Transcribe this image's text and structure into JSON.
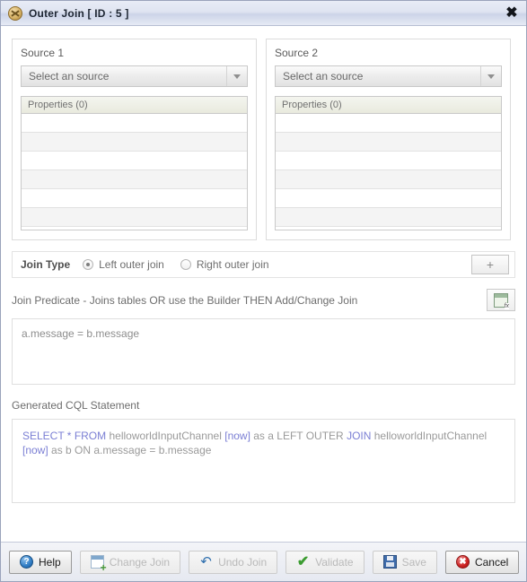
{
  "window": {
    "title": "Outer Join [ ID : 5 ]",
    "title_icon": "outer-join-icon",
    "close_label": "✖"
  },
  "sources": [
    {
      "label": "Source 1",
      "combo_value": "Select an source",
      "combo_arrow": "chevron-down-icon",
      "properties_header": "Properties (0)",
      "rows": 7
    },
    {
      "label": "Source 2",
      "combo_value": "Select an source",
      "combo_arrow": "chevron-down-icon",
      "properties_header": "Properties (0)",
      "rows": 7
    }
  ],
  "join_type": {
    "label": "Join Type",
    "options": [
      {
        "label": "Left outer join",
        "checked": true
      },
      {
        "label": "Right outer join",
        "checked": false
      }
    ],
    "add_button_label": "+"
  },
  "predicate": {
    "label": "Join Predicate - Joins tables OR use the Builder THEN Add/Change Join",
    "builder_icon": "expression-builder-icon",
    "value": "a.message  =  b.message"
  },
  "generated_cql": {
    "label": "Generated CQL Statement",
    "tokens": [
      {
        "text": "SELECT",
        "type": "keyword"
      },
      {
        "text": " * ",
        "type": "keyword"
      },
      {
        "text": "FROM",
        "type": "keyword"
      },
      {
        "text": "  helloworldInputChannel ",
        "type": "identifier"
      },
      {
        "text": "[now]",
        "type": "keyword"
      },
      {
        "text": " as a LEFT OUTER ",
        "type": "identifier"
      },
      {
        "text": "JOIN",
        "type": "keyword"
      },
      {
        "text": "  helloworldInputChannel ",
        "type": "identifier"
      },
      {
        "text": "[now]",
        "type": "keyword"
      },
      {
        "text": " as b ON a.message  =  b.message",
        "type": "identifier"
      }
    ],
    "plain_text": "SELECT * FROM  helloworldInputChannel [now] as a LEFT OUTER JOIN  helloworldInputChannel [now] as b ON a.message  =  b.message"
  },
  "buttons": [
    {
      "label": "Help",
      "icon": "help-icon",
      "enabled": true,
      "icon_class": "ico-help"
    },
    {
      "label": "Change Join",
      "icon": "change-join-icon",
      "enabled": false,
      "icon_class": "ico-changejoin"
    },
    {
      "label": "Undo Join",
      "icon": "undo-icon",
      "enabled": false,
      "icon_class": "ico-undo"
    },
    {
      "label": "Validate",
      "icon": "validate-icon",
      "enabled": false,
      "icon_class": "ico-validate"
    },
    {
      "label": "Save",
      "icon": "save-icon",
      "enabled": false,
      "icon_class": "ico-save"
    },
    {
      "label": "Cancel",
      "icon": "cancel-icon",
      "enabled": true,
      "icon_class": "ico-cancel"
    }
  ],
  "colors": {
    "titlebar_text": "#1e2633",
    "keyword": "#7b7fd4",
    "identifier": "#9a9a9a",
    "help_blue": "#2f7cc4",
    "cancel_red": "#cc2222",
    "validate_green": "#3c9c31"
  }
}
